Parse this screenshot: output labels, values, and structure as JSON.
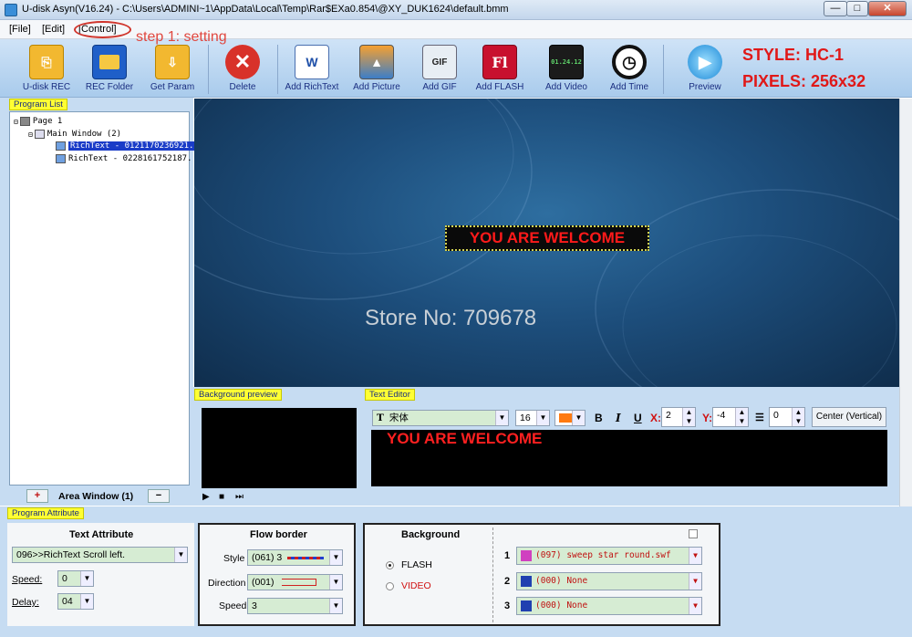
{
  "window": {
    "title": "U-disk Asyn(V16.24) - C:\\Users\\ADMINI~1\\AppData\\Local\\Temp\\Rar$EXa0.854\\@XY_DUK1624\\default.bmm",
    "btn_min": "—",
    "btn_max": "□",
    "btn_close": "✕"
  },
  "menu": {
    "file": "[File]",
    "edit": "[Edit]",
    "control": "[Control]"
  },
  "annotation": {
    "step": "step 1: setting"
  },
  "toolbar": {
    "udisk_rec": "U-disk REC",
    "rec_folder": "REC Folder",
    "get_param": "Get Param",
    "delete": "Delete",
    "add_richtext": "Add RichText",
    "add_picture": "Add Picture",
    "add_gif": "Add GIF",
    "add_flash": "Add FLASH",
    "add_video": "Add Video",
    "add_time": "Add Time",
    "preview": "Preview",
    "gif_badge": "GIF",
    "flash_badge": "Fl",
    "video_badge": "01.24.12",
    "word_badge": "W"
  },
  "overlay": {
    "style": "STYLE: HC-1",
    "pixels": "PIXELS: 256x32"
  },
  "program_list": {
    "label": "Program List",
    "tree": {
      "page": "Page 1",
      "window": "Main Window  (2)",
      "item1": "RichText - 0121170236921.",
      "item2": "RichText - 0228161752187."
    },
    "area_window": "Area Window (1)",
    "add": "+",
    "remove": "−"
  },
  "preview": {
    "sign_text": "YOU ARE WELCOME",
    "watermark": "Store No: 709678"
  },
  "background_preview": {
    "label": "Background preview"
  },
  "text_editor": {
    "label": "Text Editor",
    "font": "宋体",
    "size": "16",
    "bold": "B",
    "italic": "I",
    "underline": "U",
    "x_label": "X:",
    "x_value": "2",
    "y_label": "Y:",
    "y_value": "-4",
    "spacing_value": "0",
    "center_btn": "Center (Vertical)",
    "content": "YOU ARE WELCOME",
    "text_color": "#ff2020",
    "swatch_color": "#ff7a10"
  },
  "program_attribute": {
    "label": "Program Attribute",
    "text_attr": {
      "title": "Text Attribute",
      "effect": "096>>RichText Scroll left.",
      "speed_label": "Speed:",
      "speed": "0",
      "delay_label": "Delay:",
      "delay": "04"
    },
    "flow_border": {
      "title": "Flow border",
      "style_label": "Style",
      "style": "(061) 3",
      "direction_label": "Direction",
      "direction": "(001)",
      "speed_label": "Speed",
      "speed": "3"
    },
    "background": {
      "title": "Background",
      "flash": "FLASH",
      "video": "VIDEO",
      "rows": [
        {
          "num": "1",
          "value": "(097) sweep star round.swf"
        },
        {
          "num": "2",
          "value": "(000) None"
        },
        {
          "num": "3",
          "value": "(000) None"
        }
      ]
    }
  }
}
